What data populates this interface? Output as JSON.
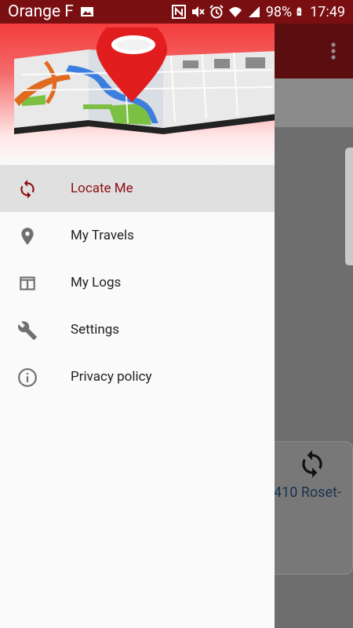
{
  "status_bar": {
    "carrier": "Orange F",
    "battery": "98%",
    "time": "17:49"
  },
  "drawer": {
    "header_image": "map-pin-header",
    "items": [
      {
        "label": "Locate Me",
        "icon": "refresh-icon",
        "active": true
      },
      {
        "label": "My Travels",
        "icon": "location-pin-icon",
        "active": false
      },
      {
        "label": "My Logs",
        "icon": "log-window-icon",
        "active": false
      },
      {
        "label": "Settings",
        "icon": "wrench-icon",
        "active": false
      },
      {
        "label": "Privacy policy",
        "icon": "info-icon",
        "active": false
      }
    ]
  },
  "background_card": {
    "text": "410 Roset-"
  },
  "colors": {
    "accent": "#8b1014",
    "statusbar": "#7a0f12",
    "header_red": "#f43c3c"
  }
}
